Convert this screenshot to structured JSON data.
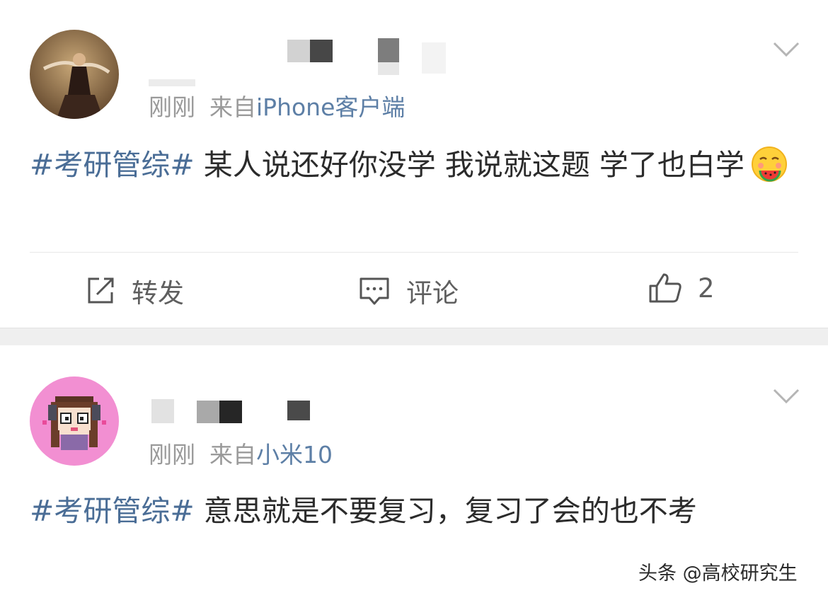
{
  "posts": [
    {
      "meta": {
        "time": "刚刚",
        "from_prefix": "来自",
        "source": "iPhone客户端"
      },
      "content": {
        "hashtag": "#考研管综#",
        "text": " 某人说还好你没学 我说就这题 学了也白学"
      },
      "emoji": "watermelon-emoji",
      "actions": {
        "repost": "转发",
        "comment": "评论",
        "like_count": "2"
      }
    },
    {
      "meta": {
        "time": "刚刚",
        "from_prefix": "来自",
        "source": "小米10"
      },
      "content": {
        "hashtag": "#考研管综#",
        "text": " 意思就是不要复习，复习了会的也不考"
      }
    }
  ],
  "watermark": "头条 @高校研究生",
  "colors": {
    "link": "#4a6d96",
    "meta": "#9a9a9a",
    "text": "#2b2b2b",
    "divider_band": "#efefef"
  }
}
